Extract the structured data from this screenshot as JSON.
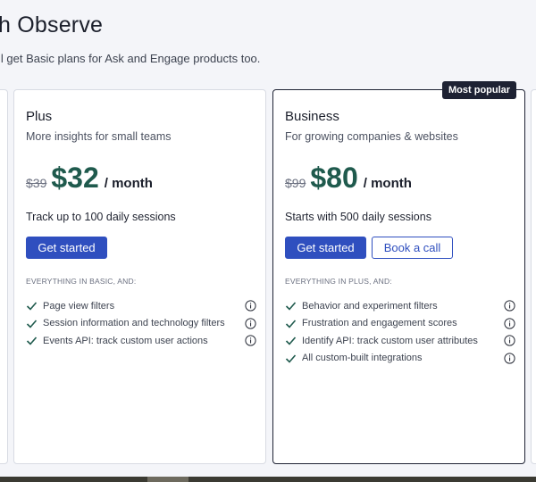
{
  "header": {
    "title": "h Observe",
    "subtitle": "ll get Basic plans for Ask and Engage products too."
  },
  "colors": {
    "accent": "#2f4fbf",
    "price": "#1f5a4d",
    "check": "#1f5a4d",
    "badge": "#1e2233"
  },
  "plans": [
    {
      "name": "Plus",
      "description": "More insights for small teams",
      "old_price": "$39",
      "price": "$32",
      "period": "/ month",
      "sessions": "Track up to 100 daily sessions",
      "primary_cta": "Get started",
      "features_heading": "EVERYTHING IN BASIC, AND:",
      "features": [
        {
          "text": "Page view filters",
          "icon": "info-icon"
        },
        {
          "text": "Session information and technology filters",
          "icon": "info-icon"
        },
        {
          "text": "Events API: track custom user actions",
          "icon": "info-icon"
        }
      ]
    },
    {
      "name": "Business",
      "badge": "Most popular",
      "description": "For growing companies & websites",
      "old_price": "$99",
      "price": "$80",
      "period": "/ month",
      "sessions": "Starts with 500 daily sessions",
      "primary_cta": "Get started",
      "secondary_cta": "Book a call",
      "features_heading": "EVERYTHING IN PLUS, AND:",
      "features": [
        {
          "text": "Behavior and experiment filters",
          "icon": "info-icon"
        },
        {
          "text": "Frustration and engagement scores",
          "icon": "info-icon"
        },
        {
          "text": "Identify API: track custom user attributes",
          "icon": "info-icon"
        },
        {
          "text": "All custom-built integrations",
          "icon": "info-icon"
        }
      ]
    }
  ]
}
